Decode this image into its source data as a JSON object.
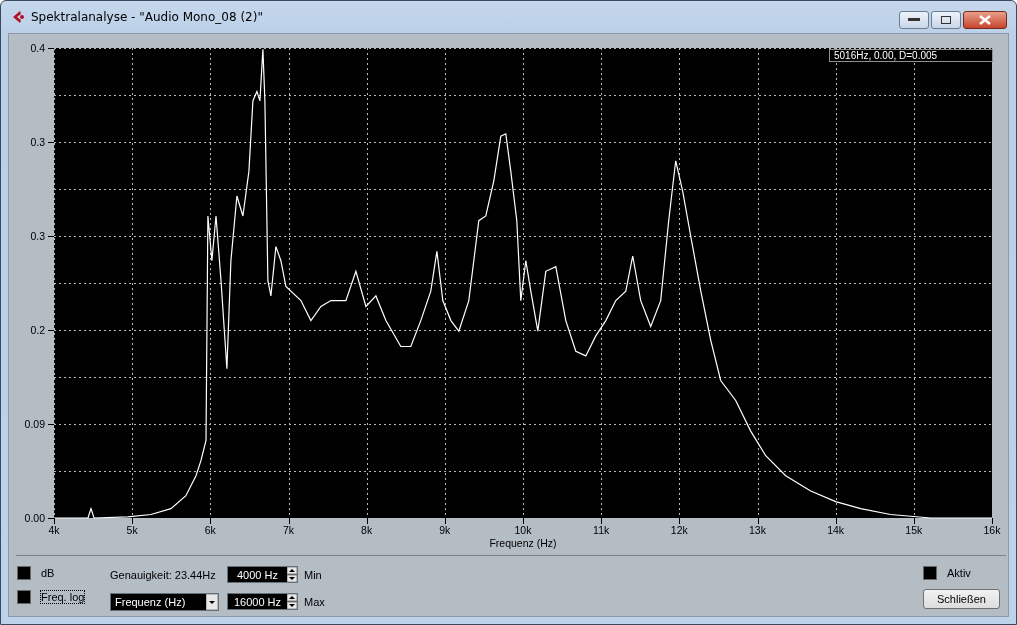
{
  "window": {
    "title": "Spektralanalyse - \"Audio Mono_08 (2)\""
  },
  "analysis": {
    "readout": "5016Hz, 0.00, D=0.005",
    "y_axis_intermediate_labels": [
      "0.3",
      "0.3",
      "0.2",
      "0.09"
    ],
    "chart_data": {
      "type": "line",
      "xlabel": "Frequenz (Hz)",
      "xlim": [
        4000,
        16000
      ],
      "ylim": [
        0,
        0.4
      ],
      "xticks": [
        {
          "value": 4000,
          "label": "4k"
        },
        {
          "value": 5000,
          "label": "5k"
        },
        {
          "value": 6000,
          "label": "6k"
        },
        {
          "value": 7000,
          "label": "7k"
        },
        {
          "value": 8000,
          "label": "8k"
        },
        {
          "value": 9000,
          "label": "9k"
        },
        {
          "value": 10000,
          "label": "10k"
        },
        {
          "value": 11000,
          "label": "11k"
        },
        {
          "value": 12000,
          "label": "12k"
        },
        {
          "value": 13000,
          "label": "13k"
        },
        {
          "value": 14000,
          "label": "14k"
        },
        {
          "value": 15000,
          "label": "15k"
        },
        {
          "value": 16000,
          "label": "16k"
        }
      ],
      "yticks": [
        {
          "value": 0,
          "label": "0.00"
        },
        {
          "value": 0.4,
          "label": "0.4"
        }
      ],
      "grid": true,
      "x": [
        4000,
        4345,
        4435,
        4473,
        4512,
        4946,
        5240,
        5496,
        5688,
        5816,
        5880,
        5944,
        5969,
        6020,
        6072,
        6136,
        6212,
        6263,
        6340,
        6417,
        6494,
        6545,
        6596,
        6634,
        6673,
        6698,
        6737,
        6775,
        6839,
        6903,
        6967,
        7159,
        7286,
        7414,
        7542,
        7734,
        7862,
        7990,
        8118,
        8246,
        8437,
        8565,
        8693,
        8821,
        8898,
        8974,
        9077,
        9179,
        9307,
        9435,
        9524,
        9627,
        9716,
        9780,
        9844,
        9921,
        9972,
        10036,
        10100,
        10189,
        10292,
        10419,
        10547,
        10675,
        10803,
        10931,
        11059,
        11187,
        11315,
        11404,
        11506,
        11634,
        11762,
        11864,
        11954,
        12043,
        12146,
        12274,
        12402,
        12529,
        12721,
        12913,
        13105,
        13361,
        13680,
        14000,
        14320,
        14703,
        15215,
        16000
      ],
      "series": [
        {
          "color": "#ffffff",
          "values": [
            0,
            0,
            0,
            0.008,
            0,
            0.001,
            0.003,
            0.008,
            0.019,
            0.036,
            0.049,
            0.066,
            0.257,
            0.219,
            0.257,
            0.202,
            0.127,
            0.219,
            0.274,
            0.257,
            0.295,
            0.355,
            0.363,
            0.355,
            0.399,
            0.355,
            0.202,
            0.189,
            0.231,
            0.219,
            0.197,
            0.185,
            0.168,
            0.18,
            0.185,
            0.185,
            0.21,
            0.18,
            0.189,
            0.168,
            0.146,
            0.146,
            0.168,
            0.193,
            0.227,
            0.185,
            0.168,
            0.159,
            0.185,
            0.253,
            0.257,
            0.287,
            0.325,
            0.327,
            0.295,
            0.253,
            0.185,
            0.219,
            0.193,
            0.159,
            0.21,
            0.214,
            0.168,
            0.142,
            0.138,
            0.155,
            0.168,
            0.185,
            0.193,
            0.223,
            0.185,
            0.163,
            0.185,
            0.253,
            0.304,
            0.278,
            0.24,
            0.193,
            0.151,
            0.117,
            0.1,
            0.074,
            0.053,
            0.036,
            0.023,
            0.014,
            0.008,
            0.003,
            0,
            0
          ]
        }
      ]
    }
  },
  "controls": {
    "db": {
      "label": "dB",
      "checked": false
    },
    "freq_log": {
      "label": "Freq. log",
      "checked": false
    },
    "accuracy": "Genauigkeit: 23.44Hz",
    "min": {
      "value": "4000 Hz",
      "label": "Min"
    },
    "max": {
      "value": "16000 Hz",
      "label": "Max"
    },
    "display_dropdown": {
      "value": "Frequenz (Hz)"
    },
    "active": {
      "label": "Aktiv",
      "checked": false
    },
    "close_button": "Schließen"
  }
}
